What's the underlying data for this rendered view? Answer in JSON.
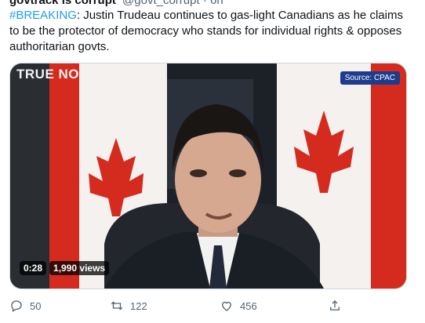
{
  "tweet": {
    "author_cut": "govtrack is corrupt",
    "handle_cut": "@govt_corrupt · 6h",
    "hashtag": "#BREAKING",
    "text": ": Justin Trudeau continues to gas-light Canadians as he claims to be the protector of democracy who stands for individual rights & opposes authoritarian govts."
  },
  "video": {
    "brand": "TRUE NORTH",
    "source": "Source: CPAC",
    "time": "0:28",
    "views": "1,990 views"
  },
  "actions": {
    "reply_count": "50",
    "retweet_count": "122",
    "like_count": "456"
  },
  "icons": [
    "reply-icon",
    "retweet-icon",
    "like-icon",
    "share-icon"
  ],
  "colors": {
    "link": "#1d9bf0",
    "muted": "#536471",
    "flag_red": "#d52b1e"
  }
}
